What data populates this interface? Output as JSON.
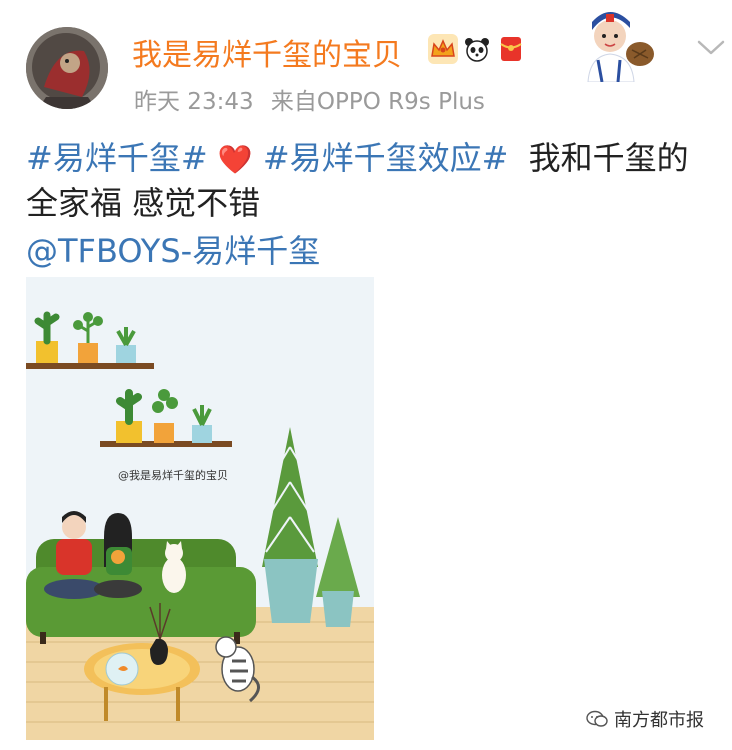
{
  "post": {
    "username": "我是易烊千玺的宝贝",
    "badges": [
      "crown-badge-icon",
      "panda-icon",
      "red-packet-icon"
    ],
    "timestamp": "昨天 23:43",
    "source": "来自OPPO R9s Plus",
    "hashtag1": "#易烊千玺#",
    "heart": "❤️",
    "hashtag2": "#易烊千玺效应#",
    "text1": "我和千玺的",
    "text2": "全家福 感觉不错",
    "mention": "@TFBOYS-易烊千玺"
  },
  "image": {
    "caption": "@我是易烊千玺的宝贝"
  },
  "watermark": {
    "text": "南方都市报"
  },
  "colors": {
    "username": "#f47a1f",
    "link": "#3b76b5",
    "meta": "#9a9a9a"
  }
}
